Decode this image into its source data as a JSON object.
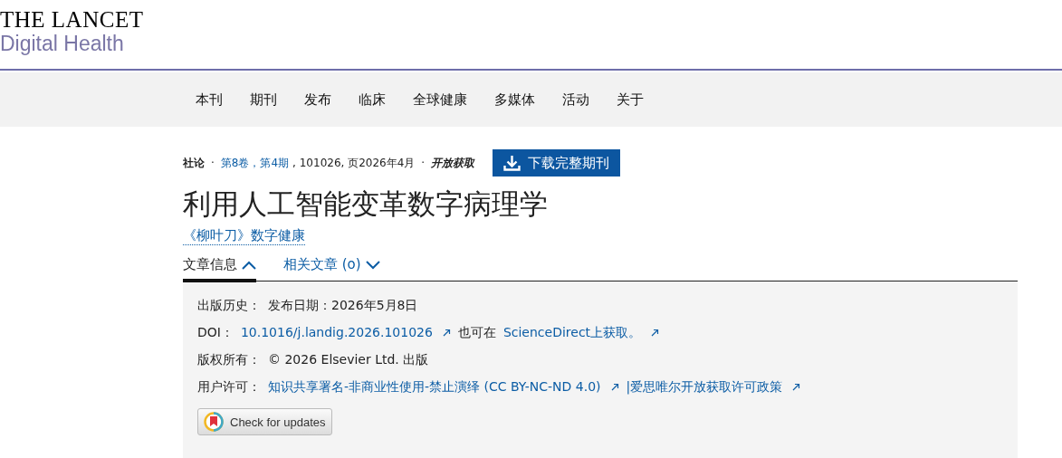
{
  "logo": {
    "title": "THE LANCET",
    "subtitle": "Digital Health"
  },
  "nav": [
    "本刊",
    "期刊",
    "发布",
    "临床",
    "全球健康",
    "多媒体",
    "活动",
    "关于"
  ],
  "meta": [
    {
      "kind": "label",
      "text": "社论"
    },
    {
      "kind": "sep",
      "text": "·"
    },
    {
      "kind": "link",
      "text": "第8卷，第4期"
    },
    {
      "kind": "text",
      "text": ", 101026, 页2026年4月"
    },
    {
      "kind": "sep",
      "text": "·"
    },
    {
      "kind": "badge",
      "text": "开放获取"
    }
  ],
  "download_button": "下载完整期刊",
  "title": "利用人工智能变革数字病理学",
  "journal_link": "《柳叶刀》数字健康",
  "tabs": [
    {
      "label": "文章信息",
      "selected": true,
      "expanded": true
    },
    {
      "label": "相关文章 (o)",
      "selected": false,
      "expanded": false
    }
  ],
  "info_rows": [
    {
      "label": "出版历史：",
      "parts": [
        {
          "kind": "text",
          "text": "发布日期：2026年5月8日"
        }
      ]
    },
    {
      "label": "DOI：",
      "parts": [
        {
          "kind": "link",
          "text": "10.1016/j.landig.2026.101026"
        },
        {
          "kind": "text",
          "text": "也可在"
        },
        {
          "kind": "link",
          "text": "ScienceDirect上获取。"
        }
      ]
    },
    {
      "label": "版权所有：",
      "parts": [
        {
          "kind": "text",
          "text": "© 2026 Elsevier Ltd. 出版"
        }
      ]
    },
    {
      "label": "用户许可：",
      "parts": [
        {
          "kind": "link",
          "text": "知识共享署名-非商业性使用-禁止演绎 (CC BY-NC-ND 4.0)"
        },
        {
          "kind": "link",
          "text": "|爱思唯尔开放获取许可政策"
        }
      ]
    }
  ],
  "check_button": "Check for updates"
}
